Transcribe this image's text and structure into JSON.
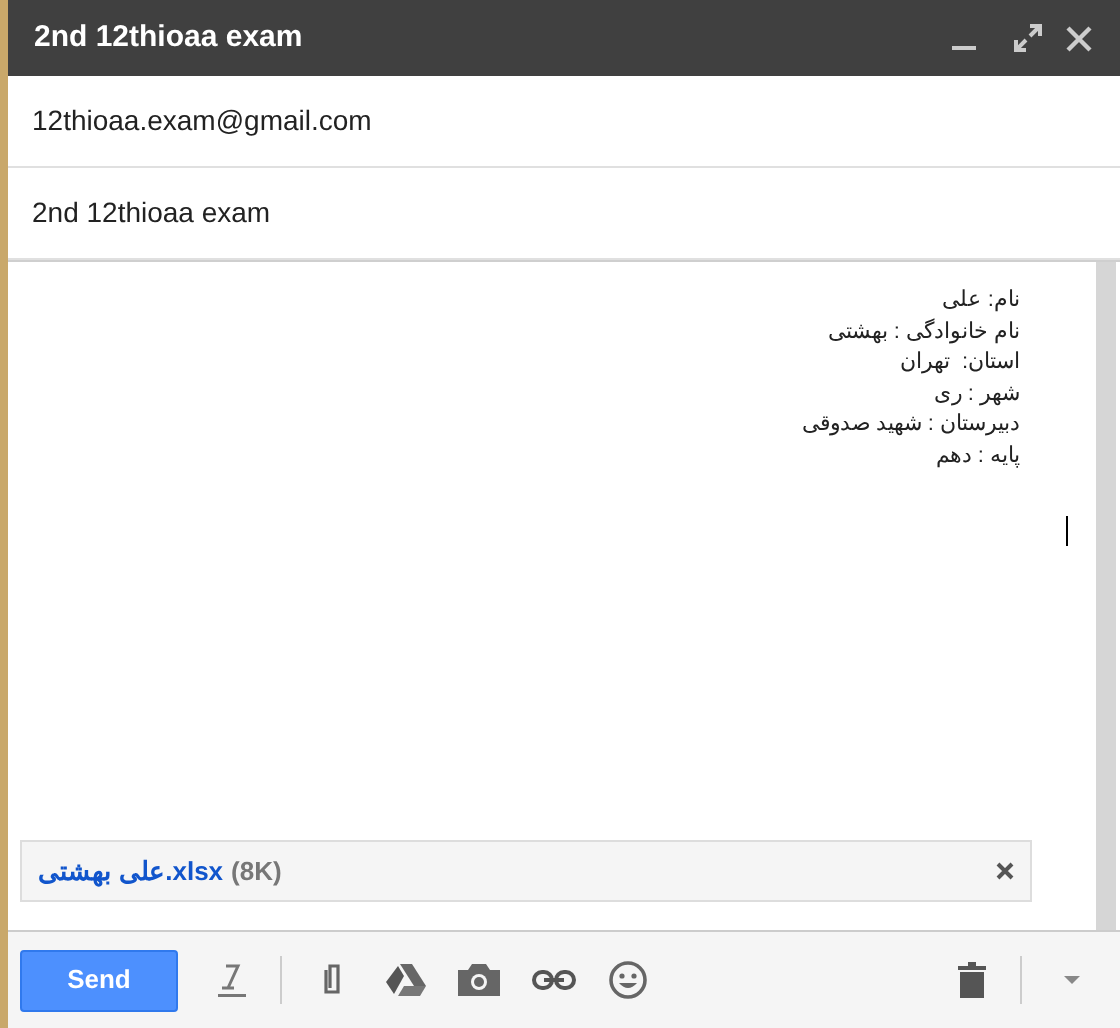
{
  "window": {
    "title": "2nd 12thioaa exam"
  },
  "to": {
    "value": "12thioaa.exam@gmail.com"
  },
  "subject": {
    "value": "2nd 12thioaa exam"
  },
  "body": {
    "lines": [
      "نام: علی",
      "نام خانوادگی : بهشتی",
      "استان:  تهران",
      "شهر : ری",
      "دبیرستان : شهید صدوقی",
      "پایه : دهم"
    ]
  },
  "attachment": {
    "name": "علی بهشتی.xlsx",
    "size": "(8K)"
  },
  "toolbar": {
    "send": "Send"
  }
}
